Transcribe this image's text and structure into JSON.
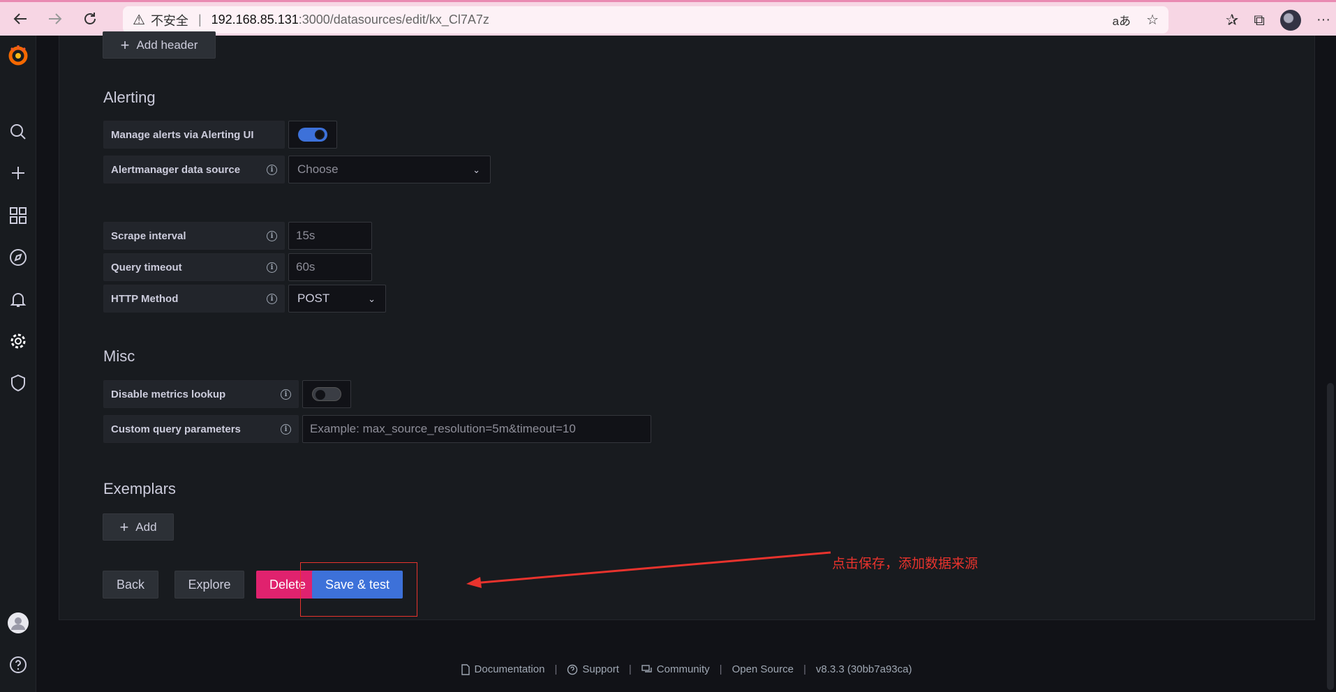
{
  "browser": {
    "insecure_label": "不安全",
    "separator": "|",
    "url_host": "192.168.85.131",
    "url_path": ":3000/datasources/edit/kx_Cl7A7z"
  },
  "page": {
    "add_header_label": "Add header",
    "alerting": {
      "title": "Alerting",
      "manage_alerts_label": "Manage alerts via Alerting UI",
      "manage_alerts_enabled": true,
      "alertmanager_label": "Alertmanager data source",
      "alertmanager_placeholder": "Choose"
    },
    "query": {
      "scrape_label": "Scrape interval",
      "scrape_placeholder": "15s",
      "timeout_label": "Query timeout",
      "timeout_placeholder": "60s",
      "method_label": "HTTP Method",
      "method_value": "POST"
    },
    "misc": {
      "title": "Misc",
      "disable_lookup_label": "Disable metrics lookup",
      "disable_lookup_enabled": false,
      "custom_params_label": "Custom query parameters",
      "custom_params_placeholder": "Example: max_source_resolution=5m&timeout=10"
    },
    "exemplars": {
      "title": "Exemplars",
      "add_label": "Add"
    },
    "actions": {
      "back": "Back",
      "explore": "Explore",
      "delete": "Delete",
      "save_test": "Save & test"
    }
  },
  "annotation": {
    "text": "点击保存，添加数据来源"
  },
  "footer": {
    "documentation": "Documentation",
    "support": "Support",
    "community": "Community",
    "open_source": "Open Source",
    "version": "v8.3.3 (30bb7a93ca)",
    "sep": "|"
  },
  "colors": {
    "primary": "#3d71d9",
    "destructive": "#e0226e",
    "annotation": "#e8332d"
  }
}
